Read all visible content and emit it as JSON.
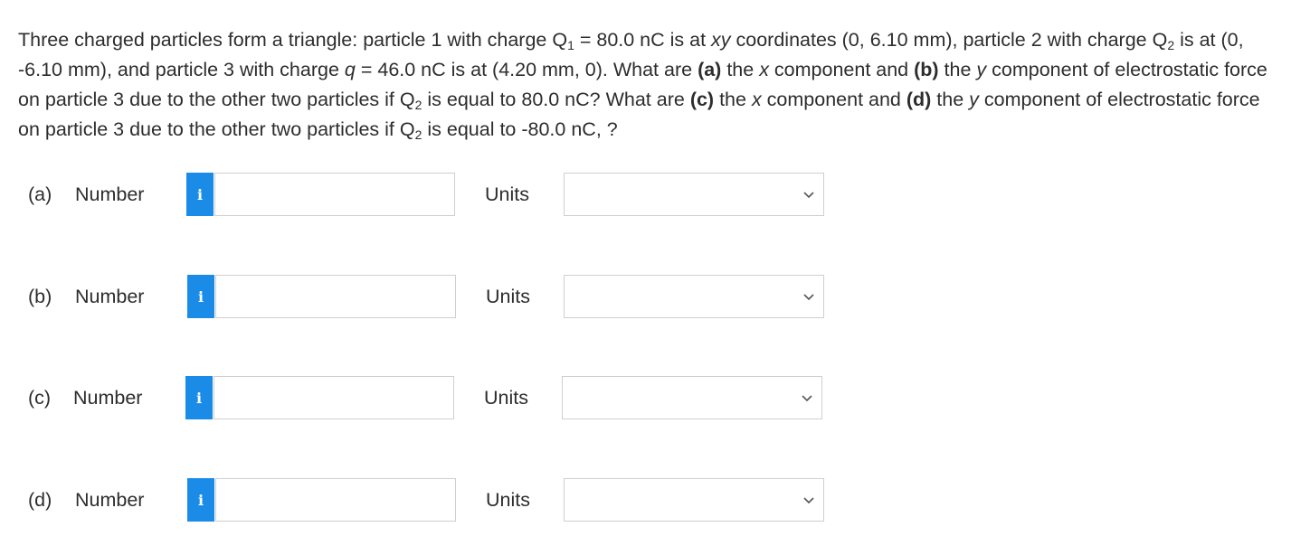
{
  "question": {
    "t1": "Three charged particles form a triangle: particle 1 with charge Q",
    "s1": "1",
    "t2": " = 80.0 nC is at ",
    "t3": "xy",
    "t4": " coordinates (0, 6.10 mm), particle 2 with charge Q",
    "s2": "2",
    "t5": " is at (0, -6.10 mm), and particle 3 with charge ",
    "t6": "q",
    "t7": " = 46.0 nC is at (4.20 mm, 0). What are ",
    "b1": "(a)",
    "t8": " the ",
    "t9": "x",
    "t10": " component and ",
    "b2": "(b)",
    "t11": " the ",
    "t12": "y",
    "t13": " component of electrostatic force on particle 3 due to the other two particles if Q",
    "s3": "2",
    "t14": " is equal to 80.0 nC? What are ",
    "b3": "(c)",
    "t15": " the ",
    "t16": "x",
    "t17": " component and ",
    "b4": "(d)",
    "t18": " the ",
    "t19": "y",
    "t20": " component of electrostatic force on particle 3 due to the other two particles if Q",
    "s4": "2",
    "t21": " is equal to -80.0 nC, ?"
  },
  "parts": [
    {
      "label": "(a)",
      "number_label": "Number",
      "info_icon": "i",
      "value": "",
      "units_label": "Units",
      "units_value": ""
    },
    {
      "label": "(b)",
      "number_label": "Number",
      "info_icon": "i",
      "value": "",
      "units_label": "Units",
      "units_value": ""
    },
    {
      "label": "(c)",
      "number_label": "Number",
      "info_icon": "i",
      "value": "",
      "units_label": "Units",
      "units_value": ""
    },
    {
      "label": "(d)",
      "number_label": "Number",
      "info_icon": "i",
      "value": "",
      "units_label": "Units",
      "units_value": ""
    }
  ],
  "colors": {
    "info_button": "#1a8ce8",
    "border": "#cfcfcf",
    "text": "#2d2d2d"
  }
}
